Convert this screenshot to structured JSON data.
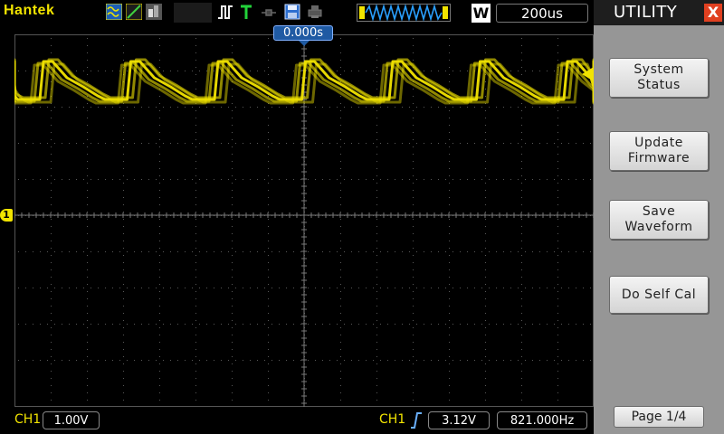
{
  "header": {
    "brand": "Hantek",
    "run_mode": "W",
    "timebase": "200us",
    "trigger_position": "0.000s"
  },
  "icons": [
    "waveform-icon",
    "slope-icon",
    "persistence-icon",
    "pulse-icon",
    "trigger-t-icon",
    "probe-icon",
    "save-disk-icon",
    "printer-icon",
    "memory-depth-icon"
  ],
  "channel": {
    "marker": "1",
    "name": "CH1",
    "scale": "1.00V"
  },
  "trigger": {
    "source": "CH1",
    "level": "3.12V",
    "frequency": "821.000Hz"
  },
  "menu": {
    "title": "UTILITY",
    "close": "X",
    "items": [
      [
        "System",
        "Status"
      ],
      [
        "Update",
        "Firmware"
      ],
      [
        "Save",
        "Waveform"
      ],
      [
        "Do Self Cal"
      ]
    ],
    "page": "Page 1/4"
  },
  "colors": {
    "trace": "#f2e400",
    "accent": "#1f5aa3",
    "close": "#e04020",
    "menu_bg": "#969696"
  }
}
